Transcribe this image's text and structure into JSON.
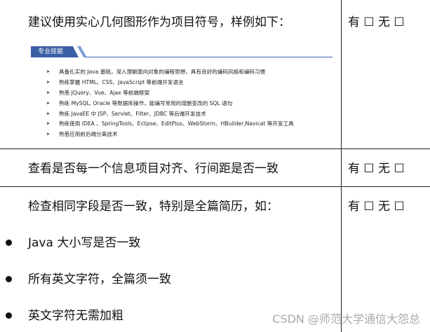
{
  "choice_text": "有 ☐ 无 ☐",
  "rows": [
    {
      "text": "建议使用实心几何图形作为项目符号，样例如下：",
      "sample": {
        "section_title": "专业技能",
        "items": [
          "具备扎实的 Java 基础，深入理解面向对象的编程思想，具有良好的编码风格和编码习惯",
          "熟练掌握 HTML、CSS、JavaScript 等前端开发语言",
          "熟悉 JQuery、Vue、Ajax 等前端框架",
          "熟练 MySQL, Oracle 等数据库操作，能编写常用的增删查改的 SQL 语句",
          "熟练 JavaEE 中 JSP、Servlet、Filter、JDBC 等后端开发技术",
          "熟练使用 IDEA 、SpringTools、Eclipse、EditPlus、WebStorm、HBuilder,Navicat 等开发工具",
          "熟悉应用前后端分离技术"
        ]
      }
    },
    {
      "text": "查看是否每一个信息项目对齐、行间距是否一致"
    },
    {
      "text": "检查相同字段是否一致，特别是全篇简历，如：",
      "bullets": [
        "Java 大小写是否一致",
        "所有英文字符，全篇须一致",
        "英文字符无需加粗"
      ]
    }
  ],
  "watermark": "CSDN @师范大学通信大怨总"
}
